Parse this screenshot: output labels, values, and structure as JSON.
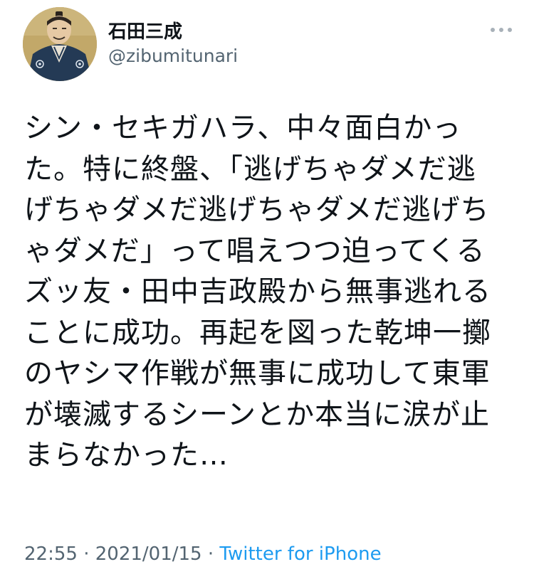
{
  "tweet": {
    "author": {
      "display_name": "石田三成",
      "handle": "@zibumitunari",
      "avatar_icon": "samurai-portrait-avatar"
    },
    "more_icon": "more-horizontal-icon",
    "text": "シン・セキガハラ、中々面白かっ\nた。特に終盤、「逃げちゃダメだ逃\nげちゃダメだ逃げちゃダメだ逃げち\nゃダメだ」って唱えつつ迫ってくる\nズッ友・田中吉政殿から無事逃れる\nことに成功。再起を図った乾坤一擲\nのヤシマ作戦が無事に成功して東軍\nが壊滅するシーンとか本当に涙が止\nまらなかった…",
    "meta": {
      "time": "22:55",
      "separator": " · ",
      "date": "2021/01/15",
      "source": "Twitter for iPhone"
    }
  },
  "colors": {
    "text": "#0f1419",
    "secondary": "#536471",
    "link": "#1d9bf0"
  }
}
